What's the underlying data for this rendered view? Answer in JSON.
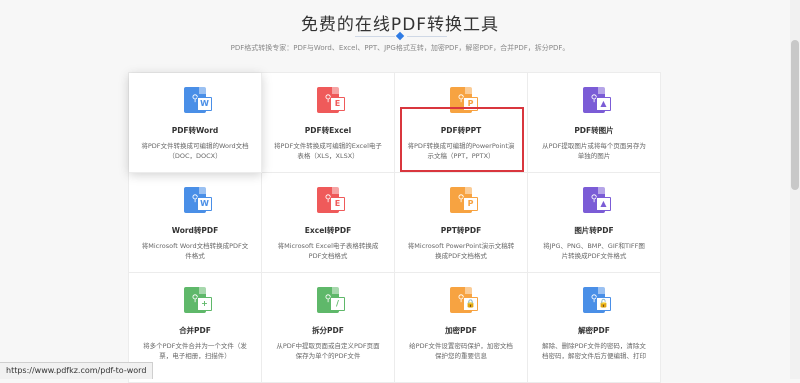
{
  "header": {
    "title": "免费的在线PDF转换工具",
    "subtitle": "PDF格式转换专家：PDF与Word、Excel、PPT、JPG格式互转，加密PDF，解密PDF，合并PDF，拆分PDF。"
  },
  "tools": [
    {
      "name": "PDF转Word",
      "desc": "将PDF文件转换成可编辑的Word文档（DOC，DOCX）",
      "icon": "pdf-to-word-icon",
      "color": "#4a8fe7",
      "badge": "W",
      "glyph": "⚲"
    },
    {
      "name": "PDF转Excel",
      "desc": "将PDF文件转换成可编辑的Excel电子表格（XLS，XLSX）",
      "icon": "pdf-to-excel-icon",
      "color": "#ef5a5a",
      "badge": "E",
      "glyph": "⚲"
    },
    {
      "name": "PDF转PPT",
      "desc": "将PDF转换成可编辑的PowerPoint演示文稿（PPT，PPTX）",
      "icon": "pdf-to-ppt-icon",
      "color": "#f7a341",
      "badge": "P",
      "glyph": "⚲"
    },
    {
      "name": "PDF转图片",
      "desc": "从PDF提取图片或将每个页面另存为单独的图片",
      "icon": "pdf-to-image-icon",
      "color": "#7b5cd6",
      "badge": "▲",
      "glyph": "⚲"
    },
    {
      "name": "Word转PDF",
      "desc": "将Microsoft Word文档转换成PDF文件格式",
      "icon": "word-to-pdf-icon",
      "color": "#4a8fe7",
      "badge": "W",
      "glyph": "⚲"
    },
    {
      "name": "Excel转PDF",
      "desc": "将Microsoft Excel电子表格转换成PDF文档格式",
      "icon": "excel-to-pdf-icon",
      "color": "#ef5a5a",
      "badge": "E",
      "glyph": "⚲"
    },
    {
      "name": "PPT转PDF",
      "desc": "将Microsoft PowerPoint演示文稿转换成PDF文档格式",
      "icon": "ppt-to-pdf-icon",
      "color": "#f7a341",
      "badge": "P",
      "glyph": "⚲"
    },
    {
      "name": "图片转PDF",
      "desc": "将JPG、PNG、BMP、GIF和TIFF图片转换成PDF文件格式",
      "icon": "image-to-pdf-icon",
      "color": "#7b5cd6",
      "badge": "▲",
      "glyph": "⚲"
    },
    {
      "name": "合并PDF",
      "desc": "将多个PDF文件合并为一个文件（发票，电子相册，扫描件）",
      "icon": "merge-pdf-icon",
      "color": "#5fb86a",
      "badge": "+",
      "glyph": "⚲"
    },
    {
      "name": "拆分PDF",
      "desc": "从PDF中提取页面或自定义PDF页面保存为单个的PDF文件",
      "icon": "split-pdf-icon",
      "color": "#5fb86a",
      "badge": "/",
      "glyph": "⚲"
    },
    {
      "name": "加密PDF",
      "desc": "给PDF文件设置密码保护，加密文档保护您的重要信息",
      "icon": "encrypt-pdf-icon",
      "color": "#f7a341",
      "badge": "🔒",
      "glyph": "⚲"
    },
    {
      "name": "解密PDF",
      "desc": "解除、删除PDF文件的密码，清除文档密码，解密文件后方便编辑、打印",
      "icon": "decrypt-pdf-icon",
      "color": "#4a8fe7",
      "badge": "🔓",
      "glyph": "⚲"
    }
  ],
  "status": {
    "url": "https://www.pdfkz.com/pdf-to-word"
  }
}
